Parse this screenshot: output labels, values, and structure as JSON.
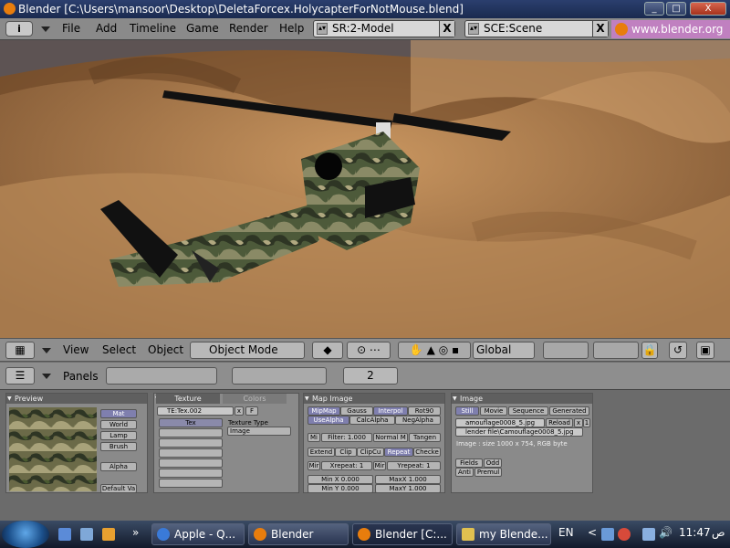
{
  "window": {
    "title": "Blender [C:\\Users\\mansoor\\Desktop\\DeletaForcex.HolycapterForNotMouse.blend]",
    "min": "_",
    "max": "□",
    "close": "X"
  },
  "topmenu": {
    "info": "i",
    "items": [
      "File",
      "Add",
      "Timeline",
      "Game",
      "Render",
      "Help"
    ]
  },
  "screen_field": {
    "value": "SR:2-Model",
    "clear": "X"
  },
  "scene_field": {
    "value": "SCE:Scene",
    "clear": "X"
  },
  "link": "www.blender.org 2",
  "viewport_header": {
    "menus": [
      "View",
      "Select",
      "Object"
    ],
    "mode": "Object Mode",
    "orientation": "Global"
  },
  "buttons_header": {
    "panels_label": "Panels",
    "frame": "2"
  },
  "preview_panel": {
    "title": "Preview",
    "buttons": [
      "Mat",
      "World",
      "Lamp",
      "Brush",
      "Alpha",
      "Default Va"
    ]
  },
  "texture_panel": {
    "tabs": [
      "Texture",
      "Colors"
    ],
    "tex_name": "TE:Tex.002",
    "tex_f": "F",
    "tex_label": "Tex",
    "type_label": "Texture Type",
    "type_value": "Image"
  },
  "map_image_panel": {
    "title": "Map Image",
    "row1": [
      "MipMap",
      "Gauss",
      "Interpol",
      "Rot90"
    ],
    "row2": [
      "UseAlpha",
      "CalcAlpha",
      "NegAlpha"
    ],
    "filter": {
      "mi": "Mi",
      "filter": "Filter: 1.000",
      "normal": "Normal M",
      "tangent": "Tangen"
    },
    "ext": [
      "Extend",
      "Clip",
      "ClipCu",
      "Repeat",
      "Checke"
    ],
    "repeat": {
      "mir1": "Mir",
      "xrepeat": "Xrepeat: 1",
      "mir2": "Mir",
      "yrepeat": "Yrepeat: 1"
    },
    "minx": "Min X 0.000",
    "maxx": "MaxX 1.000",
    "miny": "Min Y 0.000",
    "maxy": "MaxY 1.000"
  },
  "image_panel": {
    "title": "Image",
    "tabs": [
      "Still",
      "Movie",
      "Sequence",
      "Generated"
    ],
    "name": "amouflage0008_5.jpg",
    "reload": "Reload",
    "x": "x",
    "users": "1",
    "path": "lender file\\Camouflage0008_5.jpg",
    "info": "Image : size 1000 x 754, RGB byte",
    "fields": "Fields",
    "odd": "Odd",
    "anti": "Anti",
    "premul": "Premul"
  },
  "taskbar": {
    "buttons": [
      "Apple - Q...",
      "Blender",
      "Blender [C:...",
      "my Blende..."
    ],
    "lang": "EN",
    "clock": "11:47",
    "ampm": "ص"
  },
  "colors": {
    "blender_orange": "#e87d0d",
    "link_bg": "#c080c0",
    "sky": "#4a6a9a"
  }
}
